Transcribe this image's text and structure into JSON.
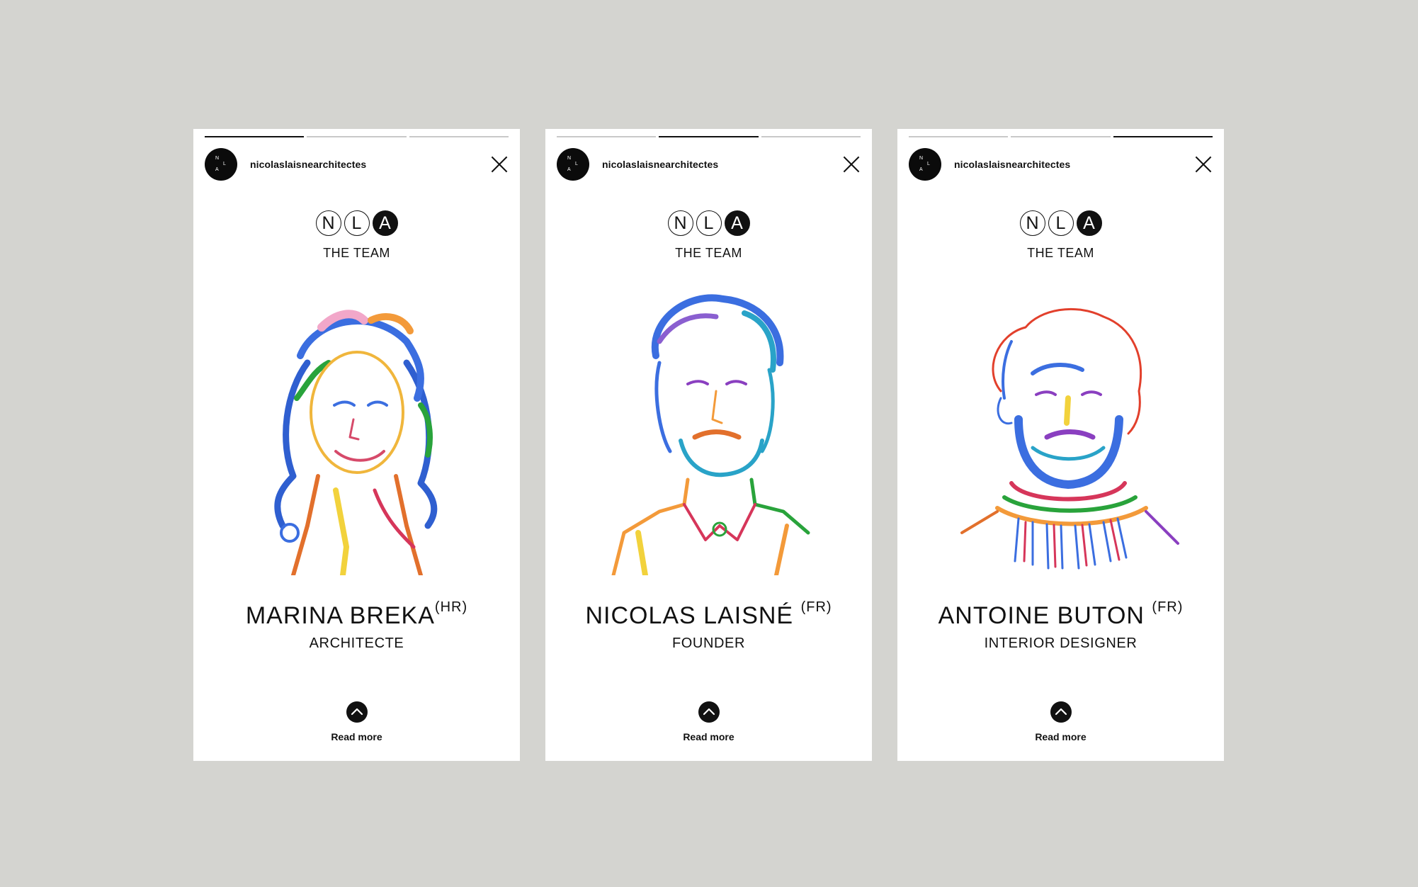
{
  "background_color": "#d4d4d0",
  "accent_color": "#111111",
  "story_cards": [
    {
      "progress": {
        "segments": 3,
        "active_index": 0
      },
      "account_handle": "nicolaslaisnearchitectes",
      "logo_letters": [
        "N",
        "L",
        "A"
      ],
      "section_label": "THE TEAM",
      "person_name": "MARINA BREKA",
      "country_code": "(HR)",
      "role": "ARCHITECTE",
      "read_more_label": "Read more",
      "portrait_icon": "portrait-woman-icon"
    },
    {
      "progress": {
        "segments": 3,
        "active_index": 1
      },
      "account_handle": "nicolaslaisnearchitectes",
      "logo_letters": [
        "N",
        "L",
        "A"
      ],
      "section_label": "THE TEAM",
      "person_name": "NICOLAS LAISNÉ",
      "country_code": "(FR)",
      "role": "FOUNDER",
      "read_more_label": "Read more",
      "portrait_icon": "portrait-man-icon"
    },
    {
      "progress": {
        "segments": 3,
        "active_index": 2
      },
      "account_handle": "nicolaslaisnearchitectes",
      "logo_letters": [
        "N",
        "L",
        "A"
      ],
      "section_label": "THE TEAM",
      "person_name": "ANTOINE BUTON",
      "country_code": "(FR)",
      "role": "INTERIOR DESIGNER",
      "read_more_label": "Read more",
      "portrait_icon": "portrait-bearded-man-icon"
    }
  ]
}
